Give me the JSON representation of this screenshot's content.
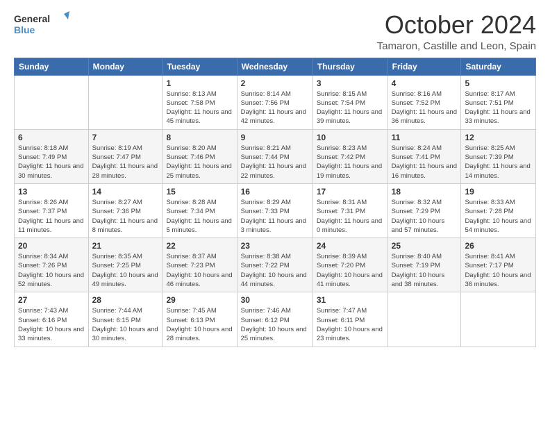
{
  "header": {
    "logo_line1": "General",
    "logo_line2": "Blue",
    "month": "October 2024",
    "location": "Tamaron, Castille and Leon, Spain"
  },
  "weekdays": [
    "Sunday",
    "Monday",
    "Tuesday",
    "Wednesday",
    "Thursday",
    "Friday",
    "Saturday"
  ],
  "weeks": [
    [
      {
        "day": "",
        "info": ""
      },
      {
        "day": "",
        "info": ""
      },
      {
        "day": "1",
        "info": "Sunrise: 8:13 AM\nSunset: 7:58 PM\nDaylight: 11 hours and 45 minutes."
      },
      {
        "day": "2",
        "info": "Sunrise: 8:14 AM\nSunset: 7:56 PM\nDaylight: 11 hours and 42 minutes."
      },
      {
        "day": "3",
        "info": "Sunrise: 8:15 AM\nSunset: 7:54 PM\nDaylight: 11 hours and 39 minutes."
      },
      {
        "day": "4",
        "info": "Sunrise: 8:16 AM\nSunset: 7:52 PM\nDaylight: 11 hours and 36 minutes."
      },
      {
        "day": "5",
        "info": "Sunrise: 8:17 AM\nSunset: 7:51 PM\nDaylight: 11 hours and 33 minutes."
      }
    ],
    [
      {
        "day": "6",
        "info": "Sunrise: 8:18 AM\nSunset: 7:49 PM\nDaylight: 11 hours and 30 minutes."
      },
      {
        "day": "7",
        "info": "Sunrise: 8:19 AM\nSunset: 7:47 PM\nDaylight: 11 hours and 28 minutes."
      },
      {
        "day": "8",
        "info": "Sunrise: 8:20 AM\nSunset: 7:46 PM\nDaylight: 11 hours and 25 minutes."
      },
      {
        "day": "9",
        "info": "Sunrise: 8:21 AM\nSunset: 7:44 PM\nDaylight: 11 hours and 22 minutes."
      },
      {
        "day": "10",
        "info": "Sunrise: 8:23 AM\nSunset: 7:42 PM\nDaylight: 11 hours and 19 minutes."
      },
      {
        "day": "11",
        "info": "Sunrise: 8:24 AM\nSunset: 7:41 PM\nDaylight: 11 hours and 16 minutes."
      },
      {
        "day": "12",
        "info": "Sunrise: 8:25 AM\nSunset: 7:39 PM\nDaylight: 11 hours and 14 minutes."
      }
    ],
    [
      {
        "day": "13",
        "info": "Sunrise: 8:26 AM\nSunset: 7:37 PM\nDaylight: 11 hours and 11 minutes."
      },
      {
        "day": "14",
        "info": "Sunrise: 8:27 AM\nSunset: 7:36 PM\nDaylight: 11 hours and 8 minutes."
      },
      {
        "day": "15",
        "info": "Sunrise: 8:28 AM\nSunset: 7:34 PM\nDaylight: 11 hours and 5 minutes."
      },
      {
        "day": "16",
        "info": "Sunrise: 8:29 AM\nSunset: 7:33 PM\nDaylight: 11 hours and 3 minutes."
      },
      {
        "day": "17",
        "info": "Sunrise: 8:31 AM\nSunset: 7:31 PM\nDaylight: 11 hours and 0 minutes."
      },
      {
        "day": "18",
        "info": "Sunrise: 8:32 AM\nSunset: 7:29 PM\nDaylight: 10 hours and 57 minutes."
      },
      {
        "day": "19",
        "info": "Sunrise: 8:33 AM\nSunset: 7:28 PM\nDaylight: 10 hours and 54 minutes."
      }
    ],
    [
      {
        "day": "20",
        "info": "Sunrise: 8:34 AM\nSunset: 7:26 PM\nDaylight: 10 hours and 52 minutes."
      },
      {
        "day": "21",
        "info": "Sunrise: 8:35 AM\nSunset: 7:25 PM\nDaylight: 10 hours and 49 minutes."
      },
      {
        "day": "22",
        "info": "Sunrise: 8:37 AM\nSunset: 7:23 PM\nDaylight: 10 hours and 46 minutes."
      },
      {
        "day": "23",
        "info": "Sunrise: 8:38 AM\nSunset: 7:22 PM\nDaylight: 10 hours and 44 minutes."
      },
      {
        "day": "24",
        "info": "Sunrise: 8:39 AM\nSunset: 7:20 PM\nDaylight: 10 hours and 41 minutes."
      },
      {
        "day": "25",
        "info": "Sunrise: 8:40 AM\nSunset: 7:19 PM\nDaylight: 10 hours and 38 minutes."
      },
      {
        "day": "26",
        "info": "Sunrise: 8:41 AM\nSunset: 7:17 PM\nDaylight: 10 hours and 36 minutes."
      }
    ],
    [
      {
        "day": "27",
        "info": "Sunrise: 7:43 AM\nSunset: 6:16 PM\nDaylight: 10 hours and 33 minutes."
      },
      {
        "day": "28",
        "info": "Sunrise: 7:44 AM\nSunset: 6:15 PM\nDaylight: 10 hours and 30 minutes."
      },
      {
        "day": "29",
        "info": "Sunrise: 7:45 AM\nSunset: 6:13 PM\nDaylight: 10 hours and 28 minutes."
      },
      {
        "day": "30",
        "info": "Sunrise: 7:46 AM\nSunset: 6:12 PM\nDaylight: 10 hours and 25 minutes."
      },
      {
        "day": "31",
        "info": "Sunrise: 7:47 AM\nSunset: 6:11 PM\nDaylight: 10 hours and 23 minutes."
      },
      {
        "day": "",
        "info": ""
      },
      {
        "day": "",
        "info": ""
      }
    ]
  ]
}
